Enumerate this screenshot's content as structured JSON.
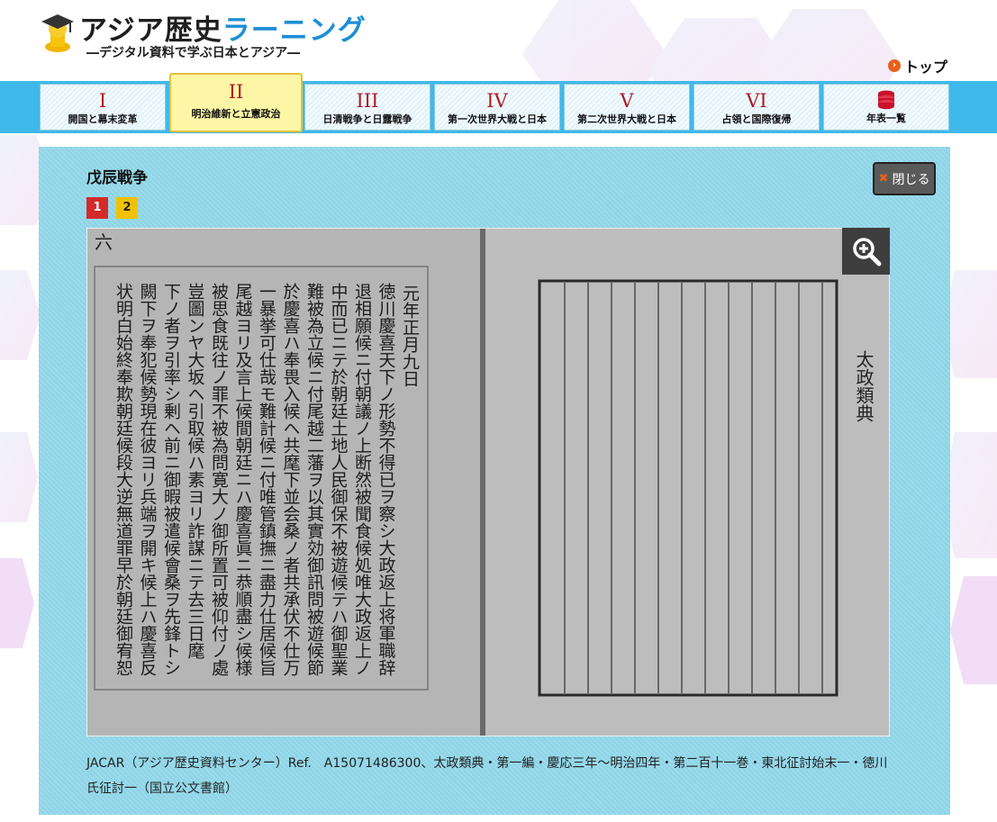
{
  "header": {
    "logo_title_dark": "アジア歴史",
    "logo_title_blue": "ラーニング",
    "logo_subtitle": "―デジタル資料で学ぶ日本とアジア―",
    "top_link": "トップ"
  },
  "nav": {
    "items": [
      {
        "num": "I",
        "label": "開国と幕末変革"
      },
      {
        "num": "II",
        "label": "明治維新と立憲政治"
      },
      {
        "num": "III",
        "label": "日清戦争と日露戦争"
      },
      {
        "num": "IV",
        "label": "第一次世界大戦と日本"
      },
      {
        "num": "V",
        "label": "第二次世界大戦と日本"
      },
      {
        "num": "VI",
        "label": "占領と国際復帰"
      },
      {
        "label": "年表一覧",
        "icon": "database-icon"
      }
    ],
    "active_index": 1
  },
  "panel": {
    "title": "戊辰戦争",
    "close_label": "閉じる",
    "pages": [
      "1",
      "2"
    ],
    "caption": "JACAR（アジア歴史資料センター）Ref.　A15071486300、太政類典・第一編・慶応三年～明治四年・第二百十一巻・東北征討始末一・徳川氏征討一（国立公文書館）"
  },
  "document_image": {
    "page_marker": "六",
    "right_label": "太政類典",
    "columns": [
      "元年正月九日",
      "徳川慶喜天下ノ形勢不得已ヲ察シ大政返上将軍職辞",
      "退相願候ニ付朝議ノ上断然被聞食候処唯大政返上ノ",
      "中而已ニテ於朝廷土地人民御保不被遊候テハ御聖業",
      "難被為立候ニ付尾越二藩ヲ以其實効御訊問被遊候節",
      "於慶喜ハ奉畏入候ヘ共麾下並会桑ノ者共承伏不仕万",
      "一暴挙可仕哉モ難計候ニ付唯管鎮撫ニ盡力仕居候旨",
      "尾越ヨリ及言上候間朝廷ニハ慶喜眞ニ恭順盡シ候様",
      "被思食既往ノ罪不被為問寛大ノ御所置可被仰付ノ處",
      "豈圖ンヤ大坂ヘ引取候ハ素ヨリ詐謀ニテ去三日麾",
      "下ノ者ヲ引率シ剰ヘ前ニ御暇被遣候會桑ヲ先鋒トシ",
      "闕下ヲ奉犯候勢現在彼ヨリ兵端ヲ開キ候上ハ慶喜反",
      "状明白始終奉欺朝廷候段大逆無道罪早於朝廷御宥恕"
    ]
  }
}
